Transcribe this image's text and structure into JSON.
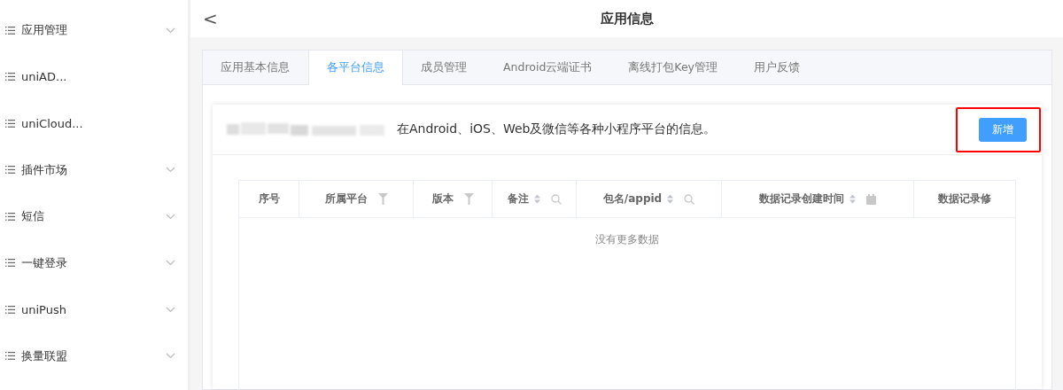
{
  "sidebar": {
    "items": [
      {
        "label": "应用管理",
        "collapsible": true
      },
      {
        "label": "uniAD...",
        "collapsible": false
      },
      {
        "label": "uniCloud...",
        "collapsible": false
      },
      {
        "label": "插件市场",
        "collapsible": true
      },
      {
        "label": "短信",
        "collapsible": true
      },
      {
        "label": "一键登录",
        "collapsible": true
      },
      {
        "label": "uniPush",
        "collapsible": true
      },
      {
        "label": "换量联盟",
        "collapsible": true
      }
    ]
  },
  "header": {
    "back": "<",
    "title": "应用信息"
  },
  "tabs": [
    {
      "label": "应用基本信息",
      "selected": false
    },
    {
      "label": "各平台信息",
      "selected": true
    },
    {
      "label": "成员管理",
      "selected": false
    },
    {
      "label": "Android云端证书",
      "selected": false
    },
    {
      "label": "离线打包Key管理",
      "selected": false
    },
    {
      "label": "用户反馈",
      "selected": false
    }
  ],
  "panel": {
    "description": "在Android、iOS、Web及微信等各种小程序平台的信息。",
    "add_button": "新增",
    "add_button_highlighted": true
  },
  "table": {
    "columns": [
      {
        "label": "序号",
        "sortable": false,
        "kind": "plain"
      },
      {
        "label": "所属平台",
        "sortable": false,
        "kind": "filter"
      },
      {
        "label": "版本",
        "sortable": false,
        "kind": "filter"
      },
      {
        "label": "备注",
        "sortable": true,
        "kind": "search"
      },
      {
        "label": "包名/appid",
        "sortable": true,
        "kind": "search"
      },
      {
        "label": "数据记录创建时间",
        "sortable": true,
        "kind": "calendar"
      },
      {
        "label": "数据记录修",
        "sortable": false,
        "kind": "plain"
      }
    ],
    "empty_text": "没有更多数据"
  }
}
